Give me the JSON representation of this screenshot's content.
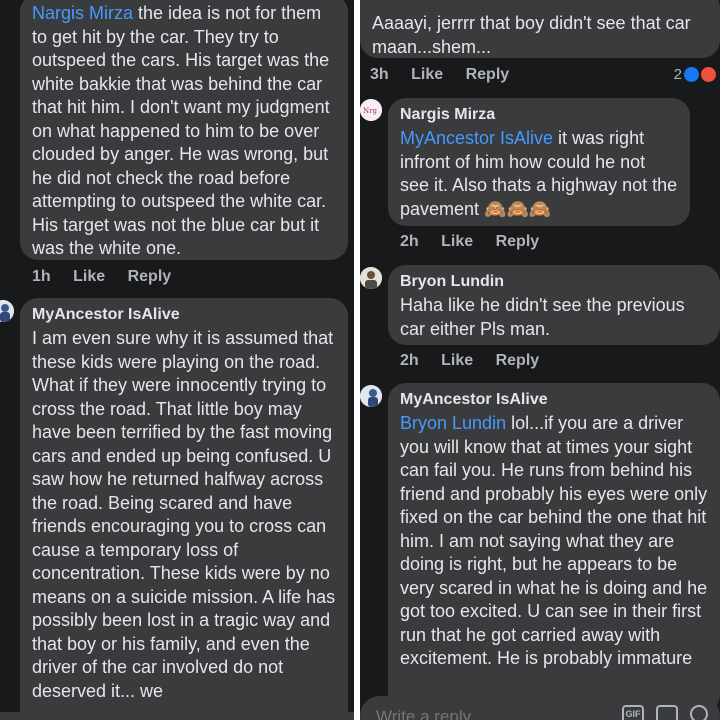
{
  "left": {
    "comment1": {
      "mention": "Nargis Mirza",
      "text": " the idea is not for them to get hit by the car. They try to outspeed the cars. His target was the white bakkie that was behind the car that hit him. I don't want my judgment on what happened to him to be over clouded by anger. He was wrong, but he did not check the road before attempting to outspeed the white car. His target was not the blue car but it was the white one.",
      "time": "1h",
      "like": "Like",
      "reply": "Reply"
    },
    "comment2": {
      "author": "MyAncestor IsAlive",
      "text": "I am even sure why it is assumed that these kids were playing on the road. What if they were innocently trying to cross the road. That little boy may have been terrified by the fast moving cars and ended up being confused. U saw how he returned halfway across the road. Being scared and have friends encouraging you to cross can cause a temporary loss of concentration. These kids were by no means on a suicide mission. A life has possibly been lost in a tragic way and that boy or his family, and even the driver of the car involved do not deserved it... we"
    }
  },
  "right": {
    "comment0": {
      "text": "Aaaayi, jerrrr that boy didn't see that car maan...shem...",
      "time": "3h",
      "like": "Like",
      "reply": "Reply",
      "reaction_count": "2",
      "like_color": "#1877f2",
      "angry_color": "#f0513c"
    },
    "comment1": {
      "author": "Nargis Mirza",
      "mention": "MyAncestor IsAlive",
      "text": " it was right infront of him how could he not see it. Also thats a highway not the pavement ",
      "emoji": "🙈🙈🙈",
      "time": "2h",
      "like": "Like",
      "reply": "Reply"
    },
    "comment2": {
      "author": "Bryon Lundin",
      "text": "Haha like he didn't see the previous car either Pls man.",
      "time": "2h",
      "like": "Like",
      "reply": "Reply"
    },
    "comment3": {
      "author": "MyAncestor IsAlive",
      "mention": "Bryon Lundin",
      "text": " lol...if you are a driver you will know that at times your sight can fail you. He runs from behind his friend and probably his eyes were only fixed on the car behind the one that hit him. I am not saying what they are doing is right, but he appears to be very  scared in what he is doing and he got too excited. U can see in their first run that he got carried away with excitement. He is probably immature"
    },
    "reply_box": {
      "placeholder": "Write a reply...",
      "gif_label": "GIF"
    }
  },
  "colors": {
    "background": "#18191a",
    "bubble": "#3a3b3c",
    "mention": "#4599ff",
    "meta": "#b0b3b8"
  }
}
